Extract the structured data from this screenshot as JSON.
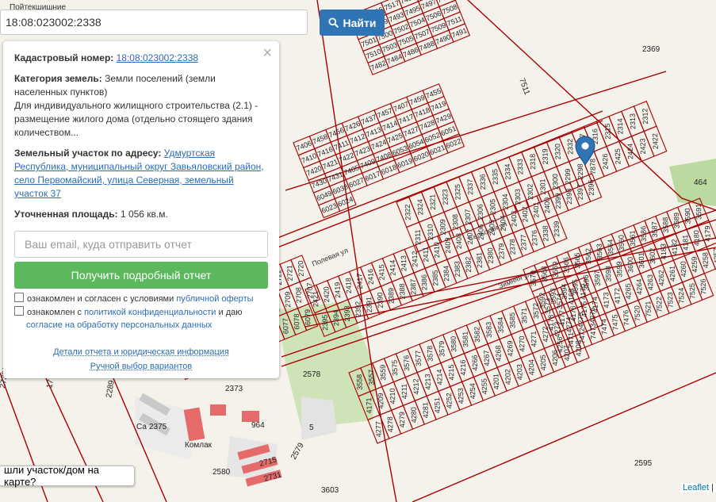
{
  "search": {
    "value": "18:08:023002:2338",
    "button_label": "Найти"
  },
  "panel": {
    "cadastral_label": "Кадастровый номер:",
    "cadastral_number": "18:08:023002:2338",
    "category_label": "Категория земель:",
    "category_value": "Земли поселений (земли населенных пунктов)",
    "use_line": "Для индивидуального жилищного строительства (2.1) - размещение жилого дома (отдельно стоящего здания количеством...",
    "address_label": "Земельный участок по адресу:",
    "address_value": "Удмуртская Республика, муниципальный округ Завьяловский район, село Первомайский, улица Северная, земельный участок 37",
    "area_label": "Уточненная площадь:",
    "area_value": "1 056 кв.м.",
    "email_placeholder": "Ваш email, куда отправить отчет",
    "report_button": "Получить подробный отчет",
    "consent1_text": "ознакомлен и согласен с условиями",
    "consent1_link": "публичной оферты",
    "consent2_text": "ознакомлен с",
    "consent2_link": "политикой конфиденциальности",
    "consent2_tail": "и даю",
    "consent2_link2": "согласие на обработку персональных данных",
    "details_link": "Детали отчета и юридическая информация",
    "manual_link": "Ручной выбор вариантов",
    "close": "×"
  },
  "found_prompt": "шли участок/дом на карте?",
  "attribution": {
    "leaflet": "Leaflet",
    "sep": "|"
  },
  "map": {
    "top_left_street": "Пойтекшишние",
    "streets": [
      "Полевая ул",
      "Сельская ул",
      "Зимняя ул"
    ],
    "plots_top": [
      "7513",
      "7515",
      "7517",
      "7481",
      "7483",
      "7485",
      "7487",
      "7489",
      "7493",
      "7495",
      "7497",
      "7499",
      "7501",
      "7500",
      "7502",
      "7504",
      "7506",
      "7508",
      "7510",
      "7503",
      "7505",
      "7507",
      "7509",
      "7511",
      "7482",
      "7484",
      "7486",
      "7488",
      "7490",
      "7491"
    ],
    "plots_mid": [
      "7406",
      "7458",
      "7456",
      "7426",
      "7437",
      "7457",
      "7407",
      "7459",
      "7455",
      "7410",
      "7416",
      "7411",
      "7412",
      "7413",
      "7414",
      "7417",
      "7418",
      "7419",
      "7420",
      "7421",
      "7422",
      "7423",
      "7424",
      "7425",
      "7427",
      "7428",
      "7429",
      "7430",
      "7431",
      "7405",
      "7409",
      "7408",
      "6053",
      "6054",
      "6052",
      "6051",
      "6049",
      "6038",
      "6027",
      "6017",
      "6018",
      "6019",
      "6020",
      "6021",
      "6022",
      "6023",
      "6024"
    ],
    "plots_low": [
      "2322",
      "2324",
      "2321",
      "2323",
      "2325",
      "2337",
      "2336",
      "2335",
      "2334",
      "2333",
      "2318",
      "2319",
      "2320",
      "2332",
      "2317",
      "2316",
      "2315",
      "2314",
      "2313",
      "2312",
      "2311",
      "2310",
      "2309",
      "2308",
      "2307",
      "2306",
      "2305",
      "2304",
      "2303",
      "2302",
      "2301",
      "2300",
      "2299",
      "2298",
      "7878",
      "2426",
      "2425",
      "2424",
      "2423",
      "2422",
      "2421",
      "2420",
      "2419",
      "2418",
      "2417",
      "2416",
      "2415",
      "2414",
      "2413",
      "2412",
      "2411",
      "2410",
      "2409",
      "2408",
      "2407",
      "2406",
      "2405",
      "2404",
      "2403",
      "2402",
      "2401",
      "2400",
      "2399",
      "2398",
      "2397",
      "2396",
      "2395",
      "2394",
      "2393",
      "2392",
      "2391",
      "2390",
      "2389",
      "2388",
      "2387",
      "2386",
      "2385",
      "2384",
      "2383",
      "2382",
      "2381",
      "2380",
      "2379",
      "2378",
      "2377",
      "2376",
      "2338",
      "2339"
    ],
    "plots_right": [
      "3570",
      "3568",
      "3569",
      "3566",
      "3565",
      "3562",
      "3563",
      "3564",
      "3560",
      "3561",
      "3586",
      "3587",
      "3588",
      "3589",
      "3590",
      "3591",
      "3592",
      "3593",
      "3594",
      "3595",
      "3596",
      "3597",
      "3598",
      "3599",
      "3600",
      "3601",
      "3602",
      "4183",
      "4182",
      "4181",
      "4180",
      "4179",
      "4178",
      "4177",
      "4176",
      "4175",
      "4174",
      "4173",
      "4172",
      "4265",
      "4264",
      "4263",
      "4262",
      "4261",
      "4260",
      "4259",
      "4258",
      "4257",
      "4256",
      "7471",
      "7472",
      "7473",
      "7474",
      "7475",
      "7476",
      "7520",
      "7521",
      "7522",
      "7523",
      "7524",
      "7525",
      "7526"
    ],
    "plots_bottom": [
      "3558",
      "3557",
      "3559",
      "3575",
      "3576",
      "3577",
      "3578",
      "3579",
      "3580",
      "3581",
      "3582",
      "3583",
      "3584",
      "3585",
      "3571",
      "3572",
      "3573",
      "3574",
      "4169",
      "4170",
      "4171",
      "4209",
      "4210",
      "4211",
      "4212",
      "4213",
      "4214",
      "4215",
      "4216",
      "4266",
      "4267",
      "4268",
      "4269",
      "4270",
      "4271",
      "4272",
      "4273",
      "4274",
      "4275",
      "4276",
      "4277",
      "4278",
      "4279",
      "4280",
      "4281",
      "4251",
      "4252",
      "4253",
      "4254",
      "4255",
      "4201",
      "4202",
      "4203",
      "4204",
      "4205",
      "4206",
      "4207",
      "4208"
    ],
    "plots_left": [
      "2728",
      "2727",
      "2726",
      "2725",
      "2729",
      "2730",
      "2731",
      "2732",
      "2724",
      "2723",
      "2722",
      "2721",
      "2720",
      "2719",
      "2718",
      "2717",
      "2716",
      "2715",
      "2714",
      "2713",
      "2712",
      "2711",
      "2710",
      "2709",
      "2708",
      "2707",
      "2706",
      "2705",
      "2704",
      "2703",
      "2702",
      "2701",
      "2700",
      "6075",
      "6076",
      "6077",
      "6078",
      "6079"
    ],
    "misc_labels": [
      "2369",
      "7511",
      "464",
      "2578",
      "2373",
      "2375",
      "964",
      "5",
      "2579",
      "2580",
      "2715",
      "2731",
      "3603",
      "2595",
      "2739/16",
      "17",
      "2289",
      "Комлак",
      "Са"
    ]
  }
}
